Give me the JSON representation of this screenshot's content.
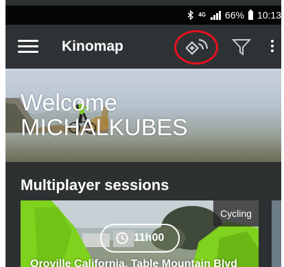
{
  "status_bar": {
    "network": "4G",
    "battery": "66%",
    "time": "10:13",
    "icons": [
      "bluetooth-icon",
      "network-4g-icon",
      "signal-icon",
      "battery-icon"
    ]
  },
  "app_bar": {
    "title": "Kinomap",
    "icons": [
      "menu-icon",
      "sensor-icon",
      "filter-icon",
      "more-options-icon"
    ],
    "highlight_color": "#e8101e"
  },
  "banner": {
    "greeting": "Welcome",
    "username": "MICHALKUBES"
  },
  "multiplayer": {
    "title": "Multiplayer sessions",
    "sessions": [
      {
        "category": "Cycling",
        "duration": "11h00",
        "title": "Oroville California, Table Mountain Blvd"
      }
    ]
  },
  "colors": {
    "appbar_bg": "#2f3234",
    "page_bg": "#2e3132",
    "accent_green": "#7fd21e"
  }
}
